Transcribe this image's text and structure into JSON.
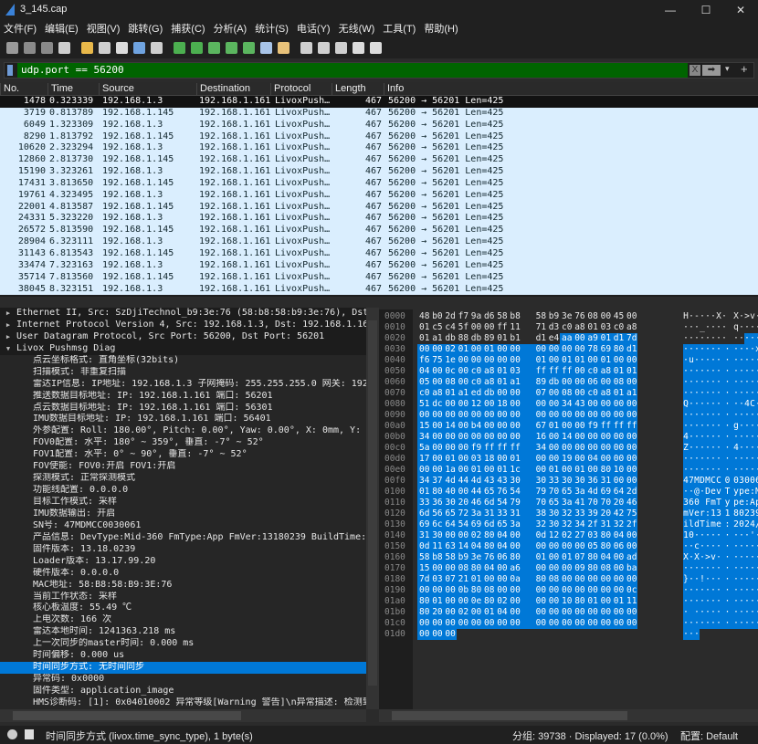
{
  "window": {
    "title": "3_145.cap",
    "minimize": "—",
    "maximize": "☐",
    "close": "✕"
  },
  "menu": [
    "文件(F)",
    "编辑(E)",
    "视图(V)",
    "跳转(G)",
    "捕获(C)",
    "分析(A)",
    "统计(S)",
    "电话(Y)",
    "无线(W)",
    "工具(T)",
    "帮助(H)"
  ],
  "toolbar": [
    "shark-fin-start-icon",
    "stop-icon",
    "restart-icon",
    "capture-options-icon",
    "open-file-icon",
    "file-icon",
    "close-file-icon",
    "reload-icon",
    "find-icon",
    "go-back-icon",
    "go-forward-icon",
    "go-to-packet-icon",
    "first-packet-icon",
    "last-packet-icon",
    "autoscroll-icon",
    "colorize-icon",
    "zoom-in-icon",
    "zoom-out-icon",
    "zoom-reset-icon",
    "resize-columns-icon",
    "layout-icon"
  ],
  "filter": {
    "value": "udp.port == 56200",
    "clear": "X",
    "apply": "➡",
    "dropdown": "▾",
    "add": "+",
    "color": "#006400"
  },
  "packet_list": {
    "columns": [
      "No.",
      "Time",
      "Source",
      "Destination",
      "Protocol",
      "Length",
      "Info"
    ],
    "rows": [
      [
        "1478",
        "0.323339",
        "192.168.1.3",
        "192.168.1.161",
        "LivoxPush…",
        "467",
        "56200 → 56201 Len=425"
      ],
      [
        "3719",
        "0.813789",
        "192.168.1.145",
        "192.168.1.161",
        "LivoxPush…",
        "467",
        "56200 → 56201 Len=425"
      ],
      [
        "6049",
        "1.323309",
        "192.168.1.3",
        "192.168.1.161",
        "LivoxPush…",
        "467",
        "56200 → 56201 Len=425"
      ],
      [
        "8290",
        "1.813792",
        "192.168.1.145",
        "192.168.1.161",
        "LivoxPush…",
        "467",
        "56200 → 56201 Len=425"
      ],
      [
        "10620",
        "2.323294",
        "192.168.1.3",
        "192.168.1.161",
        "LivoxPush…",
        "467",
        "56200 → 56201 Len=425"
      ],
      [
        "12860",
        "2.813730",
        "192.168.1.145",
        "192.168.1.161",
        "LivoxPush…",
        "467",
        "56200 → 56201 Len=425"
      ],
      [
        "15190",
        "3.323261",
        "192.168.1.3",
        "192.168.1.161",
        "LivoxPush…",
        "467",
        "56200 → 56201 Len=425"
      ],
      [
        "17431",
        "3.813650",
        "192.168.1.145",
        "192.168.1.161",
        "LivoxPush…",
        "467",
        "56200 → 56201 Len=425"
      ],
      [
        "19761",
        "4.323495",
        "192.168.1.3",
        "192.168.1.161",
        "LivoxPush…",
        "467",
        "56200 → 56201 Len=425"
      ],
      [
        "22001",
        "4.813587",
        "192.168.1.145",
        "192.168.1.161",
        "LivoxPush…",
        "467",
        "56200 → 56201 Len=425"
      ],
      [
        "24331",
        "5.323220",
        "192.168.1.3",
        "192.168.1.161",
        "LivoxPush…",
        "467",
        "56200 → 56201 Len=425"
      ],
      [
        "26572",
        "5.813590",
        "192.168.1.145",
        "192.168.1.161",
        "LivoxPush…",
        "467",
        "56200 → 56201 Len=425"
      ],
      [
        "28904",
        "6.323111",
        "192.168.1.3",
        "192.168.1.161",
        "LivoxPush…",
        "467",
        "56200 → 56201 Len=425"
      ],
      [
        "31143",
        "6.813543",
        "192.168.1.145",
        "192.168.1.161",
        "LivoxPush…",
        "467",
        "56200 → 56201 Len=425"
      ],
      [
        "33474",
        "7.323163",
        "192.168.1.3",
        "192.168.1.161",
        "LivoxPush…",
        "467",
        "56200 → 56201 Len=425"
      ],
      [
        "35714",
        "7.813560",
        "192.168.1.145",
        "192.168.1.161",
        "LivoxPush…",
        "467",
        "56200 → 56201 Len=425"
      ],
      [
        "38045",
        "8.323151",
        "192.168.1.3",
        "192.168.1.161",
        "LivoxPush…",
        "467",
        "56200 → 56201 Len=425"
      ]
    ],
    "selected_index": 0
  },
  "details": {
    "top": [
      {
        "text": "Ethernet II, Src: SzDjiTechnol_b9:3e:76 (58:b8:58:b9:3e:76), Dst: N",
        "expanded": false
      },
      {
        "text": "Internet Protocol Version 4, Src: 192.168.1.3, Dst: 192.168.1.161",
        "expanded": false
      },
      {
        "text": "User Datagram Protocol, Src Port: 56200, Dst Port: 56201",
        "expanded": false
      },
      {
        "text": "Livox Pushmsg Diag",
        "expanded": true
      }
    ],
    "fields": [
      "点云坐标格式: 直角坐标(32bits)",
      "扫描模式: 非重复扫描",
      "雷达IP信息: IP地址: 192.168.1.3 子网掩码: 255.255.255.0 网关: 192.1",
      "推送数据目标地址: IP: 192.168.1.161  端口: 56201",
      "点云数据目标地址: IP: 192.168.1.161  端口: 56301",
      "IMU数据目标地址: IP: 192.168.1.161  端口: 56401",
      "外参配置: Roll: 180.00°, Pitch: 0.00°, Yaw: 0.00°, X: 0mm, Y: 0mm",
      "FOV0配置: 水平: 180° ~ 359°, 垂直: -7° ~ 52°",
      "FOV1配置: 水平: 0° ~ 90°, 垂直: -7° ~ 52°",
      "FOV使能: FOV0:开启 FOV1:开启",
      "探测模式: 正常探测模式",
      "功能线配置: 0.0.0.0",
      "目标工作模式: 采样",
      "IMU数据输出: 开启",
      "SN号: 47MDMCC0030061",
      "产品信息: DevType:Mid-360 FmType:App FmVer:13180239 BuildTime:202",
      "固件版本: 13.18.0239",
      "Loader版本: 13.17.99.20",
      "硬件版本: 0.0.0.0",
      "MAC地址: 58:B8:58:B9:3E:76",
      "当前工作状态: 采样",
      "核心板温度: 55.49 ℃",
      "上电次数: 166 次",
      "雷达本地时间: 1241363.218 ms",
      "上一次同步的master时间: 0.000 ms",
      "时间偏移: 0.000 us",
      "时间同步方式: 无时间同步",
      "异常码: 0x0000",
      "固件类型: application_image",
      "HMS诊断码: [1]: 0x04010002  异常等级[Warning 警告]\\n异常描述: 检测到"
    ],
    "selected_field": 26
  },
  "hex": {
    "selection_start": 42,
    "lines": [
      [
        "0000",
        "48 b0 2d f7 9a d6 58 b8 58 b9 3e 76 08 00 45 00"
      ],
      [
        "0010",
        "01 c5 c4 5f 00 00 ff 11 71 d3 c0 a8 01 03 c0 a8"
      ],
      [
        "0020",
        "01 a1 db 88 db 89 01 b1 d1 e4 aa 00 a9 01 d1 7d"
      ],
      [
        "0030",
        "00 00 02 01 00 01 00 00 00 00 00 00 78 69 80 d1"
      ],
      [
        "0040",
        "f6 75 1e 00 00 00 00 00 01 00 01 01 00 01 00 00"
      ],
      [
        "0050",
        "04 00 0c 00 c0 a8 01 03 ff ff ff 00 c0 a8 01 01"
      ],
      [
        "0060",
        "05 00 08 00 c0 a8 01 a1 89 db 00 00 06 00 08 00"
      ],
      [
        "0070",
        "c0 a8 01 a1 ed db 00 00 07 00 08 00 c0 a8 01 a1"
      ],
      [
        "0080",
        "51 dc 00 00 12 00 18 00 00 00 34 43 00 00 00 00"
      ],
      [
        "0090",
        "00 00 00 00 00 00 00 00 00 00 00 00 00 00 00 00"
      ],
      [
        "00a0",
        "15 00 14 00 b4 00 00 00 67 01 00 00 f9 ff ff ff"
      ],
      [
        "00b0",
        "34 00 00 00 00 00 00 00 16 00 14 00 00 00 00 00"
      ],
      [
        "00c0",
        "5a 00 00 00 f9 ff ff ff 34 00 00 00 00 00 00 00"
      ],
      [
        "00d0",
        "17 00 01 00 03 18 00 01 00 00 19 00 04 00 00 00"
      ],
      [
        "00e0",
        "00 00 1a 00 01 00 01 1c 00 01 00 01 00 80 10 00"
      ],
      [
        "00f0",
        "34 37 4d 44 4d 43 43 30 30 33 30 30 36 31 00 00"
      ],
      [
        "0100",
        "01 80 40 00 44 65 76 54 79 70 65 3a 4d 69 64 2d"
      ],
      [
        "0110",
        "33 36 30 20 46 6d 54 79 70 65 3a 41 70 70 20 46"
      ],
      [
        "0120",
        "6d 56 65 72 3a 31 33 31 38 30 32 33 39 20 42 75"
      ],
      [
        "0130",
        "69 6c 64 54 69 6d 65 3a 32 30 32 34 2f 31 32 2f"
      ],
      [
        "0140",
        "31 30 00 00 02 80 04 00 0d 12 02 27 03 80 04 00"
      ],
      [
        "0150",
        "0d 11 63 14 04 80 04 00 00 00 00 00 05 80 06 00"
      ],
      [
        "0160",
        "58 b8 58 b9 3e 76 06 80 01 00 01 07 80 04 00 ad"
      ],
      [
        "0170",
        "15 00 00 08 80 04 00 a6 00 00 00 09 80 08 00 ba"
      ],
      [
        "0180",
        "7d 03 07 21 01 00 00 0a 80 08 00 00 00 00 00 00"
      ],
      [
        "0190",
        "00 00 00 0b 80 08 00 00 00 00 00 00 00 00 00 0c"
      ],
      [
        "01a0",
        "80 01 00 00 0e 80 02 00 00 00 10 80 01 00 01 11"
      ],
      [
        "01b0",
        "80 20 00 02 00 01 04 00 00 00 00 00 00 00 00 00"
      ],
      [
        "01c0",
        "00 00 00 00 00 00 00 00 00 00 00 00 00 00 00 00"
      ],
      [
        "01d0",
        "00 00 00"
      ]
    ],
    "selection_color": "#0078d7"
  },
  "status": {
    "field": "时间同步方式 (livox.time_sync_type), 1 byte(s)",
    "packets": "分组: 39738 · Displayed: 17 (0.0%)",
    "profile": "配置:  Default"
  }
}
